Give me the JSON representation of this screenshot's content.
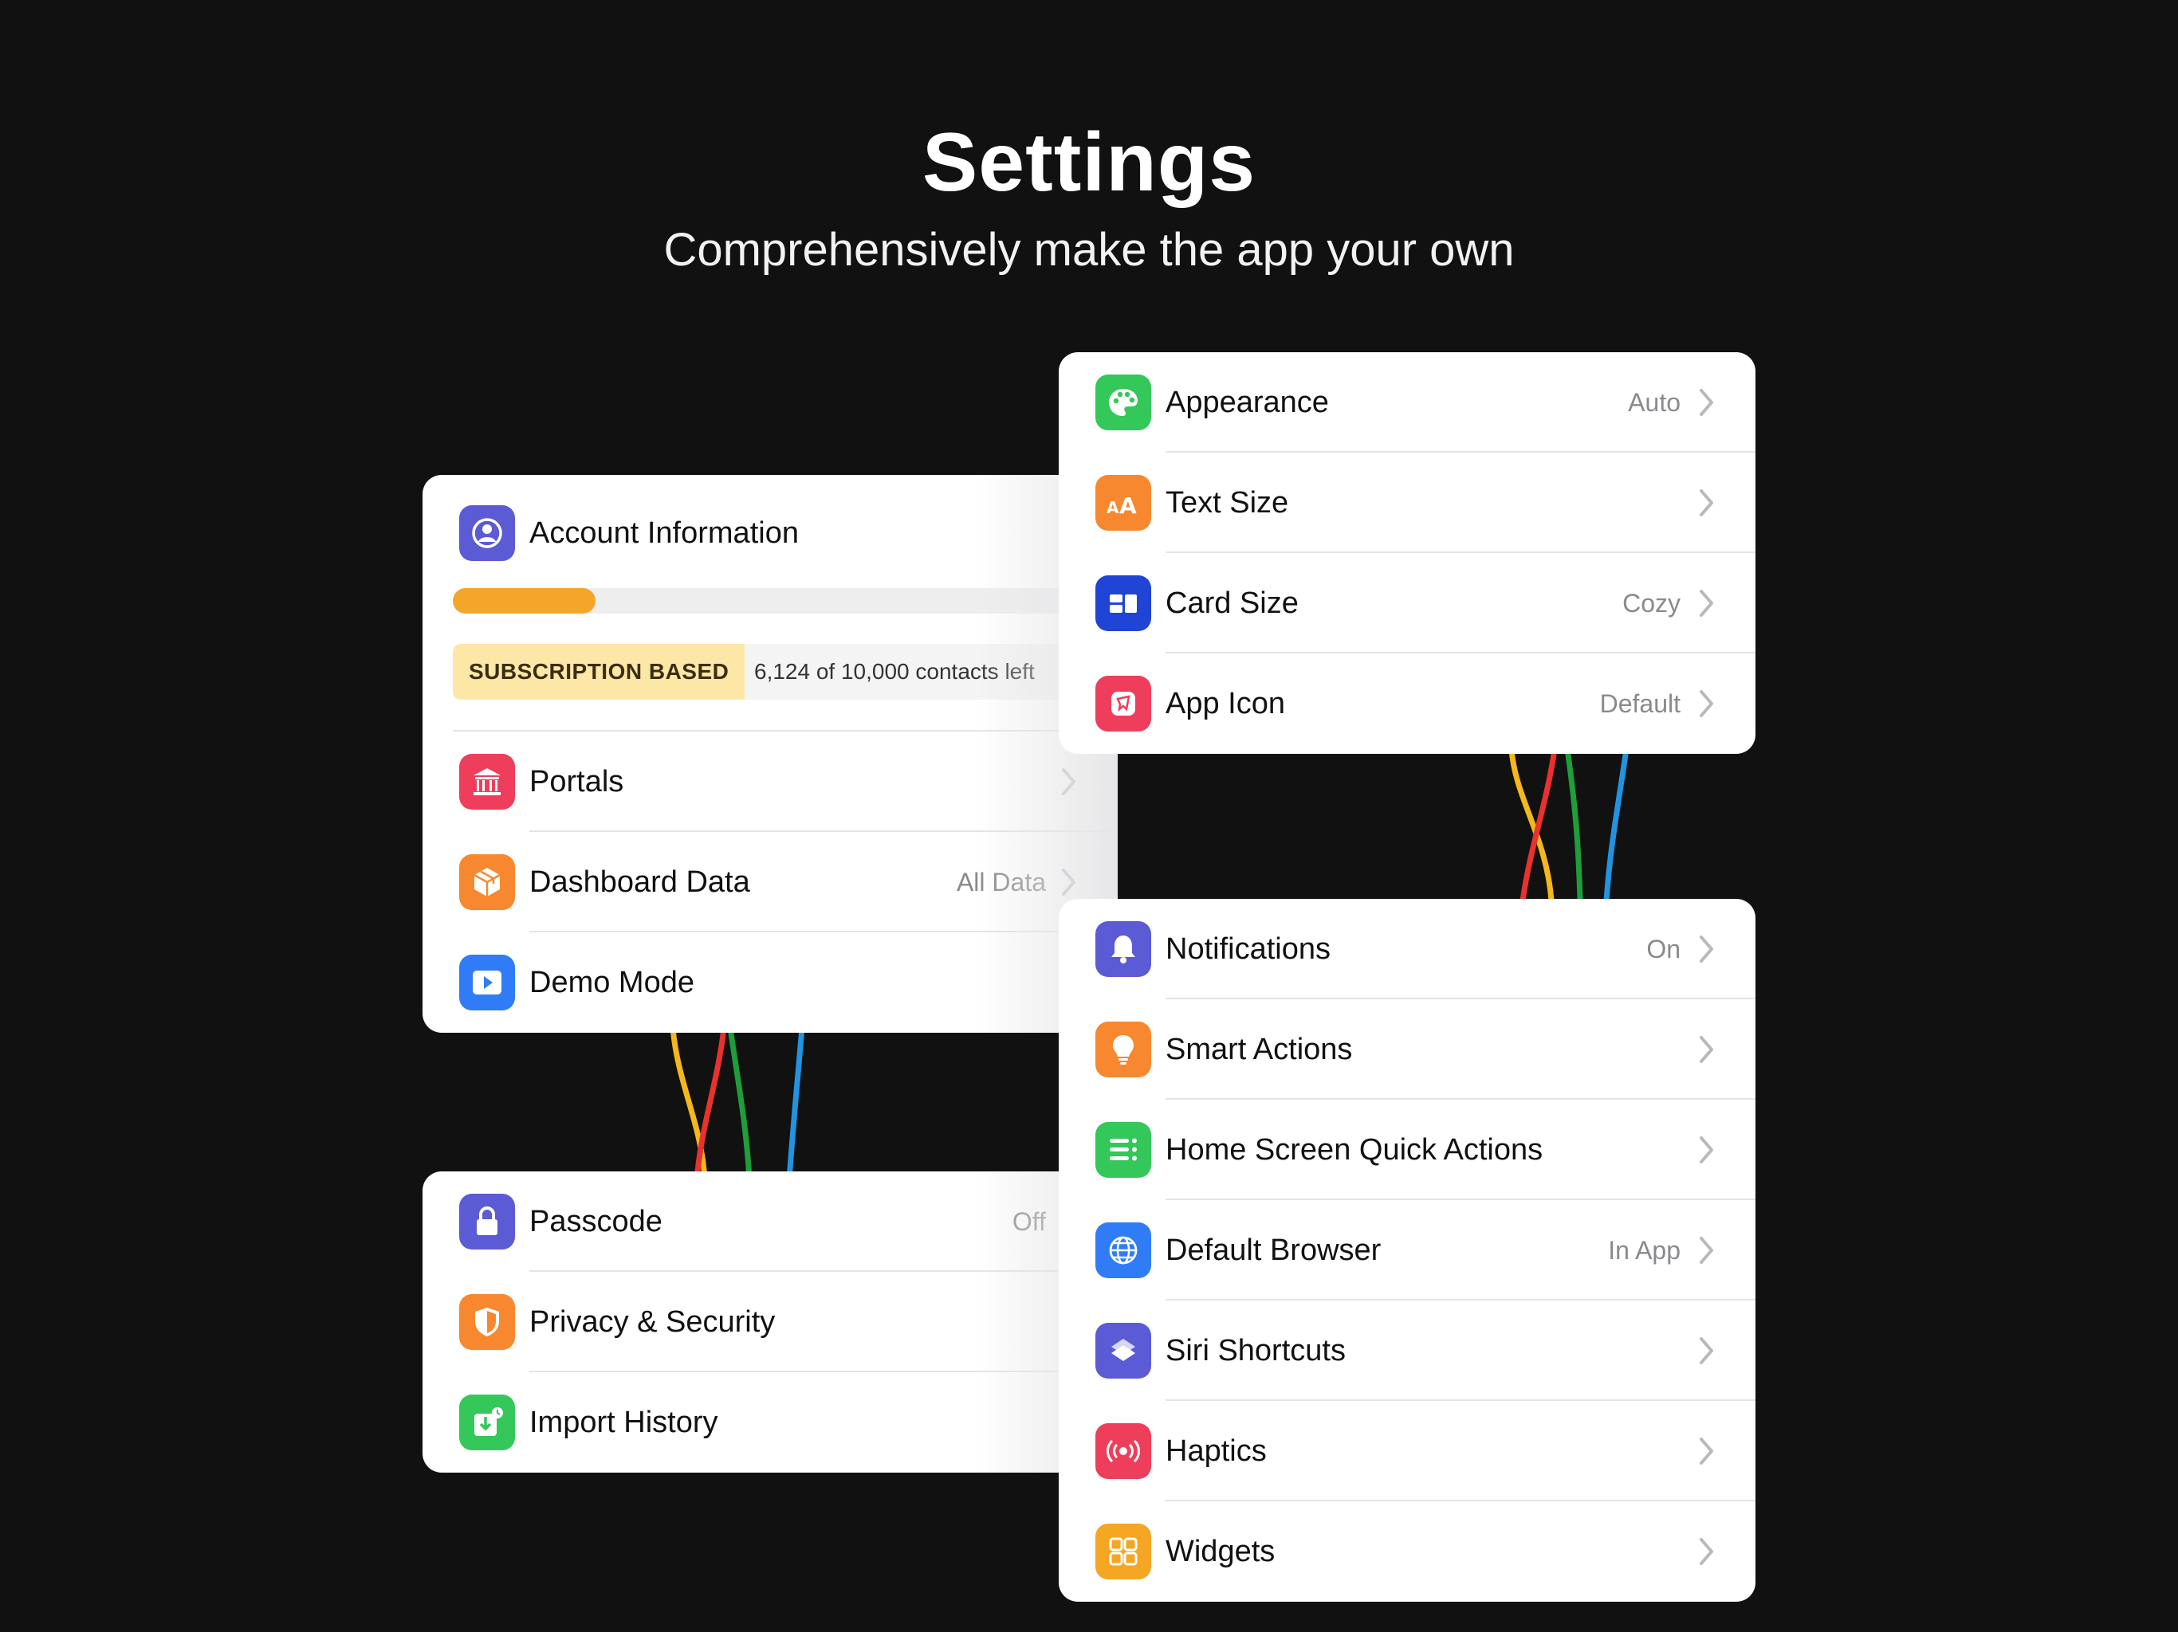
{
  "hero": {
    "title": "Settings",
    "subtitle": "Comprehensively make the app your own"
  },
  "account_card": {
    "title": "Account Information",
    "progress_fraction": 0.23,
    "subscription_badge": "SUBSCRIPTION BASED",
    "contacts_text": "6,124 of 10,000 contacts left",
    "items": [
      {
        "label": "Portals",
        "value": "",
        "icon": "bank-icon",
        "color": "#ee3e5c"
      },
      {
        "label": "Dashboard Data",
        "value": "All Data",
        "icon": "box-icon",
        "color": "#f7882f"
      },
      {
        "label": "Demo Mode",
        "value": "",
        "icon": "play-icon",
        "color": "#2f7cf6"
      }
    ]
  },
  "security_card": {
    "items": [
      {
        "label": "Passcode",
        "value": "Off",
        "icon": "lock-icon",
        "color": "#5b5bd6"
      },
      {
        "label": "Privacy & Security",
        "value": "",
        "icon": "shield-icon",
        "color": "#f7882f"
      },
      {
        "label": "Import History",
        "value": "",
        "icon": "import-icon",
        "color": "#34c759"
      }
    ]
  },
  "appearance_card": {
    "items": [
      {
        "label": "Appearance",
        "value": "Auto",
        "icon": "palette-icon",
        "color": "#34c759"
      },
      {
        "label": "Text Size",
        "value": "",
        "icon": "text-size-icon",
        "color": "#f7882f"
      },
      {
        "label": "Card Size",
        "value": "Cozy",
        "icon": "card-layout-icon",
        "color": "#1f44d6"
      },
      {
        "label": "App Icon",
        "value": "Default",
        "icon": "app-icon-icon",
        "color": "#ee3e5c"
      }
    ]
  },
  "general_card": {
    "items": [
      {
        "label": "Notifications",
        "value": "On",
        "icon": "bell-icon",
        "color": "#5b5bd6"
      },
      {
        "label": "Smart Actions",
        "value": "",
        "icon": "bulb-icon",
        "color": "#f7882f"
      },
      {
        "label": "Home Screen Quick Actions",
        "value": "",
        "icon": "list-icon",
        "color": "#34c759"
      },
      {
        "label": "Default Browser",
        "value": "In App",
        "icon": "globe-icon",
        "color": "#2f7cf6"
      },
      {
        "label": "Siri Shortcuts",
        "value": "",
        "icon": "shortcuts-icon",
        "color": "#5b5bd6"
      },
      {
        "label": "Haptics",
        "value": "",
        "icon": "haptics-icon",
        "color": "#ee3e5c"
      },
      {
        "label": "Widgets",
        "value": "",
        "icon": "widgets-icon",
        "color": "#f5a623"
      }
    ]
  },
  "colors": {
    "background": "#111111",
    "card": "#ffffff",
    "progress": "#f3a62a",
    "badge": "#fde7a6",
    "value_text": "#8a8a8e",
    "wire_yellow": "#f5b81c",
    "wire_red": "#e8322d",
    "wire_green": "#1e9e3a",
    "wire_blue": "#2293e0"
  }
}
